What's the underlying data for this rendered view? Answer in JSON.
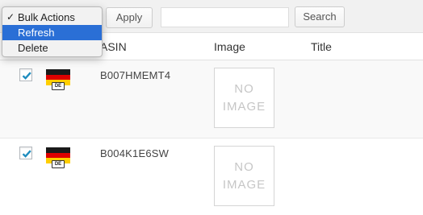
{
  "toolbar": {
    "apply_label": "Apply",
    "search_value": "",
    "search_label": "Search"
  },
  "bulk_actions_menu": {
    "items": [
      {
        "label": "Bulk Actions",
        "checked": true,
        "highlighted": false
      },
      {
        "label": "Refresh",
        "checked": false,
        "highlighted": true
      },
      {
        "label": "Delete",
        "checked": false,
        "highlighted": false
      }
    ],
    "check_glyph": "✓"
  },
  "table": {
    "columns": [
      "ASIN",
      "Image",
      "Title"
    ],
    "rows": [
      {
        "checked": true,
        "marketplace_flag": "DE",
        "asin": "B007HMEMT4",
        "image_placeholder": [
          "NO",
          "IMAGE"
        ],
        "title": ""
      },
      {
        "checked": true,
        "marketplace_flag": "DE",
        "asin": "B004K1E6SW",
        "image_placeholder": [
          "NO",
          "IMAGE"
        ],
        "title": ""
      }
    ]
  },
  "colors": {
    "accent": "#2a6fd6",
    "flag_black": "#1a1a1a",
    "flag_red": "#dd0000",
    "flag_gold": "#ffce00",
    "checkmark": "#1e8cbe"
  }
}
